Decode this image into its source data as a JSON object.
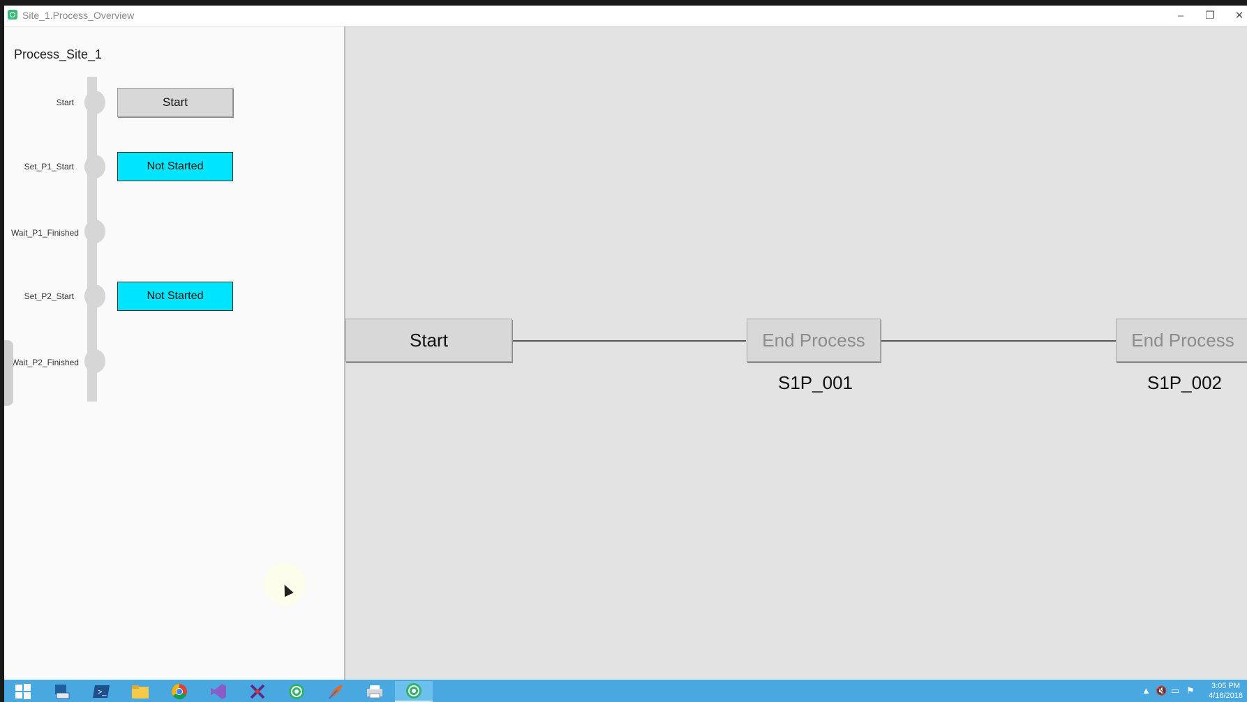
{
  "window": {
    "title": "Site_1.Process_Overview",
    "controls": {
      "minimize": "–",
      "restore": "❐",
      "close": "✕"
    }
  },
  "left_panel": {
    "title": "Process_Site_1",
    "steps": [
      {
        "label": "Start",
        "button": "Start",
        "button_style": "gray"
      },
      {
        "label": "Set_P1_Start",
        "button": "Not Started",
        "button_style": "cyan"
      },
      {
        "label": "Wait_P1_Finished",
        "button": null
      },
      {
        "label": "Set_P2_Start",
        "button": "Not Started",
        "button_style": "cyan"
      },
      {
        "label": "Wait_P2_Finished",
        "button": null
      }
    ]
  },
  "flow": {
    "nodes": [
      {
        "label": "Start",
        "caption": ""
      },
      {
        "label": "End Process",
        "caption": "S1P_001"
      },
      {
        "label": "End Process",
        "caption": "S1P_002"
      }
    ]
  },
  "taskbar": {
    "icons": [
      "windows-start-icon",
      "server-manager-icon",
      "powershell-icon",
      "file-explorer-icon",
      "chrome-icon",
      "visual-studio-icon",
      "tool-icon",
      "app-green-icon",
      "feather-icon",
      "printer-icon",
      "app-green-active-icon"
    ],
    "clock_time": "3:05 PM",
    "clock_date": "4/16/2018"
  },
  "colors": {
    "accent_cyan": "#00e5ff",
    "taskbar_blue": "#4aa8e0",
    "button_gray": "#d8d8d8",
    "canvas_bg": "#e3e3e3"
  }
}
